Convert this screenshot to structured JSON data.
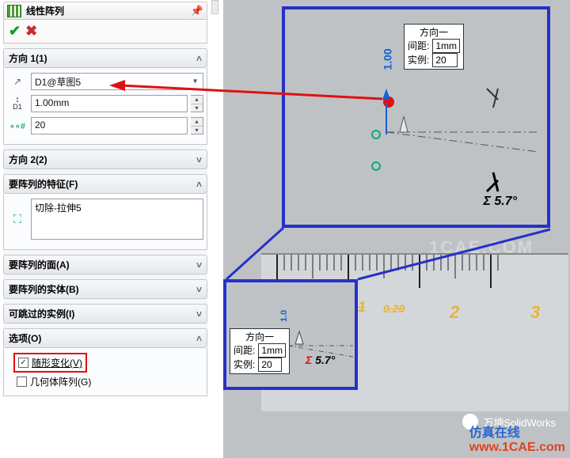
{
  "title": "线性阵列",
  "dir1": {
    "header": "方向 1(1)",
    "ref": "D1@草图5",
    "spacing": "1.00mm",
    "count": "20"
  },
  "dir2": {
    "header": "方向 2(2)"
  },
  "features": {
    "header": "要阵列的特征(F)",
    "item": "切除-拉伸5"
  },
  "faces": {
    "header": "要阵列的面(A)"
  },
  "bodies": {
    "header": "要阵列的实体(B)"
  },
  "skip": {
    "header": "可跳过的实例(I)"
  },
  "options": {
    "header": "选项(O)",
    "vary": "随形变化(V)",
    "geom": "几何体阵列(G)"
  },
  "callout": {
    "title": "方向一",
    "spacing_label": "间距:",
    "spacing_val": "1mm",
    "count_label": "实例:",
    "count_val": "20"
  },
  "dim_vert": "1.00",
  "angle": "Σ 5.7°",
  "ruler": {
    "n1": "1",
    "n2": "2",
    "n3": "3",
    "s1": "0.20"
  },
  "brand": "万坤SolidWorks",
  "site_a": "仿真在线",
  "site_b": "www.1CAE.com",
  "cae": "1CAE.COM"
}
